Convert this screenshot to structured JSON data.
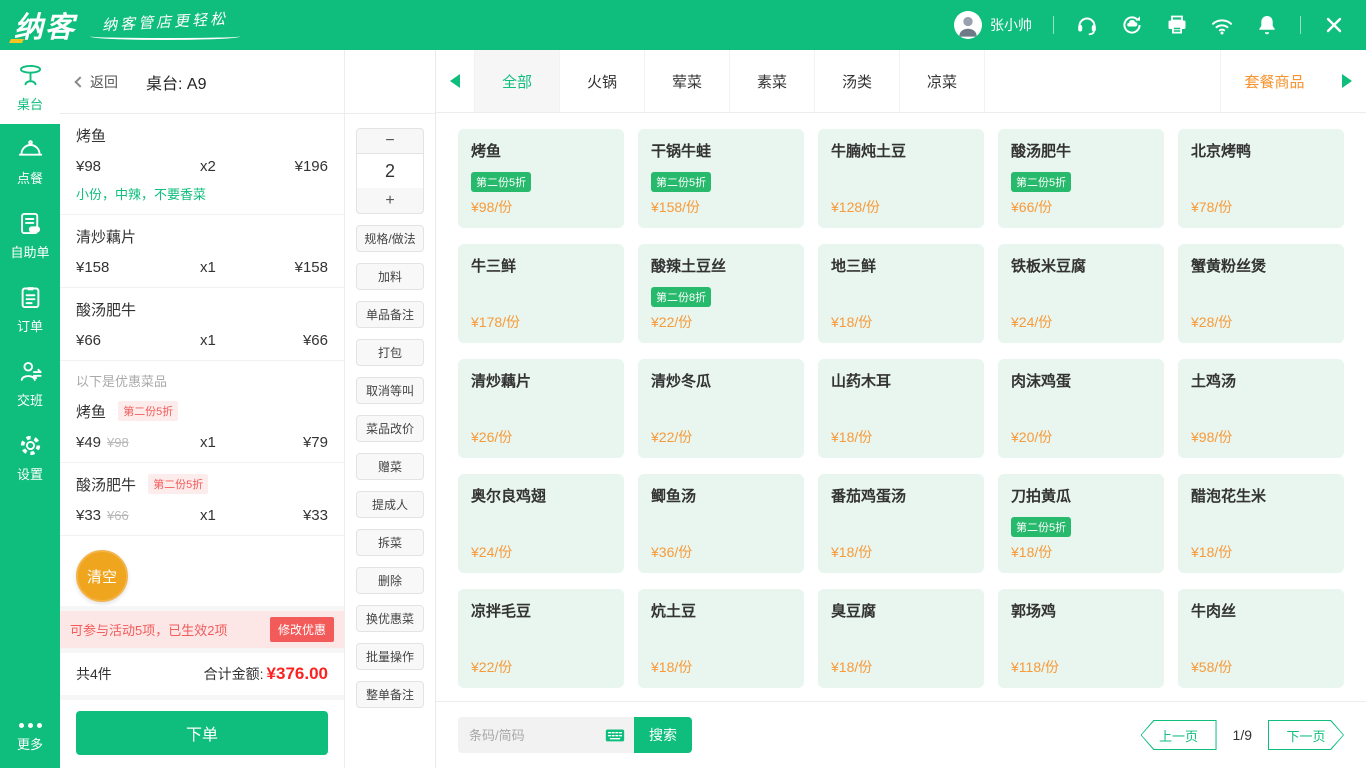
{
  "topbar": {
    "logo": "纳客",
    "tagline": "纳客管店更轻松",
    "user": "张小帅",
    "icons": [
      "headset-icon",
      "sync-icon",
      "printer-icon",
      "wifi-icon",
      "bell-icon",
      "close-icon"
    ]
  },
  "colors": {
    "brand_green": "#0fbe7d",
    "mint_card": "#e9f6ef",
    "badge_green": "#27b96c",
    "price_orange": "#f79a3a",
    "combo_orange": "#f7932e",
    "alert_red": "#f35b5b",
    "total_red": "#fb2222",
    "clear_orange": "#f0a51f"
  },
  "sidebar": {
    "items": [
      {
        "label": "桌台",
        "icon": "table-icon",
        "active": true
      },
      {
        "label": "点餐",
        "icon": "cloche-icon",
        "active": false
      },
      {
        "label": "自助单",
        "icon": "self-order-icon",
        "active": false
      },
      {
        "label": "订单",
        "icon": "order-list-icon",
        "active": false
      },
      {
        "label": "交班",
        "icon": "shift-change-icon",
        "active": false
      },
      {
        "label": "设置",
        "icon": "gear-icon",
        "active": false
      }
    ],
    "more_label": "更多"
  },
  "order_panel": {
    "back_label": "返回",
    "table_title": "桌台: A9",
    "items": [
      {
        "name": "烤鱼",
        "price": "¥98",
        "qty": "x2",
        "total": "¥196",
        "note": "小份，中辣，不要香菜"
      },
      {
        "name": "清炒藕片",
        "price": "¥158",
        "qty": "x1",
        "total": "¥158"
      },
      {
        "name": "酸汤肥牛",
        "price": "¥66",
        "qty": "x1",
        "total": "¥66"
      }
    ],
    "discount_header": "以下是优惠菜品",
    "discount_items": [
      {
        "name": "烤鱼",
        "badge": "第二份5折",
        "price": "¥49",
        "orig": "¥98",
        "qty": "x1",
        "total": "¥79"
      },
      {
        "name": "酸汤肥牛",
        "badge": "第二份5折",
        "price": "¥33",
        "orig": "¥66",
        "qty": "x1",
        "total": "¥33"
      }
    ],
    "clear_label": "清空",
    "promo_text": "可参与活动5项，已生效2项",
    "promo_button": "修改优惠",
    "count_label": "共4件",
    "total_label": "合计金额:",
    "total_amount": "¥376.00",
    "submit_label": "下单"
  },
  "actions": {
    "minus": "−",
    "qty_value": "2",
    "plus": "+",
    "buttons": [
      "规格/做法",
      "加料",
      "单品备注",
      "打包",
      "取消等叫",
      "菜品改价",
      "赠菜",
      "提成人",
      "拆菜",
      "删除",
      "换优惠菜",
      "批量操作",
      "整单备注"
    ]
  },
  "main": {
    "tabs": [
      {
        "label": "全部",
        "active": true
      },
      {
        "label": "火锅",
        "active": false
      },
      {
        "label": "荤菜",
        "active": false
      },
      {
        "label": "素菜",
        "active": false
      },
      {
        "label": "汤类",
        "active": false
      },
      {
        "label": "凉菜",
        "active": false
      }
    ],
    "combo_tab": "套餐商品"
  },
  "menu": {
    "items": [
      {
        "name": "烤鱼",
        "badge": "第二份5折",
        "price": "¥98/份"
      },
      {
        "name": "干锅牛蛙",
        "badge": "第二份5折",
        "price": "¥158/份"
      },
      {
        "name": "牛腩炖土豆",
        "price": "¥128/份"
      },
      {
        "name": "酸汤肥牛",
        "badge": "第二份5折",
        "price": "¥66/份"
      },
      {
        "name": "北京烤鸭",
        "price": "¥78/份"
      },
      {
        "name": "牛三鲜",
        "price": "¥178/份"
      },
      {
        "name": "酸辣土豆丝",
        "badge": "第二份8折",
        "price": "¥22/份"
      },
      {
        "name": "地三鲜",
        "price": "¥18/份"
      },
      {
        "name": "铁板米豆腐",
        "price": "¥24/份"
      },
      {
        "name": "蟹黄粉丝煲",
        "price": "¥28/份"
      },
      {
        "name": "清炒藕片",
        "price": "¥26/份"
      },
      {
        "name": "清炒冬瓜",
        "price": "¥22/份"
      },
      {
        "name": "山药木耳",
        "price": "¥18/份"
      },
      {
        "name": "肉沫鸡蛋",
        "price": "¥20/份"
      },
      {
        "name": "土鸡汤",
        "price": "¥98/份"
      },
      {
        "name": "奥尔良鸡翅",
        "price": "¥24/份"
      },
      {
        "name": "鲫鱼汤",
        "price": "¥36/份"
      },
      {
        "name": "番茄鸡蛋汤",
        "price": "¥18/份"
      },
      {
        "name": "刀拍黄瓜",
        "badge": "第二份5折",
        "price": "¥18/份"
      },
      {
        "name": "醋泡花生米",
        "price": "¥18/份"
      },
      {
        "name": "凉拌毛豆",
        "price": "¥22/份"
      },
      {
        "name": "炕土豆",
        "price": "¥18/份"
      },
      {
        "name": "臭豆腐",
        "price": "¥18/份"
      },
      {
        "name": "郭场鸡",
        "price": "¥118/份"
      },
      {
        "name": "牛肉丝",
        "price": "¥58/份"
      }
    ]
  },
  "footer": {
    "search_placeholder": "条码/简码",
    "search_button": "搜索",
    "prev_label": "上一页",
    "page_indicator": "1/9",
    "next_label": "下一页"
  }
}
